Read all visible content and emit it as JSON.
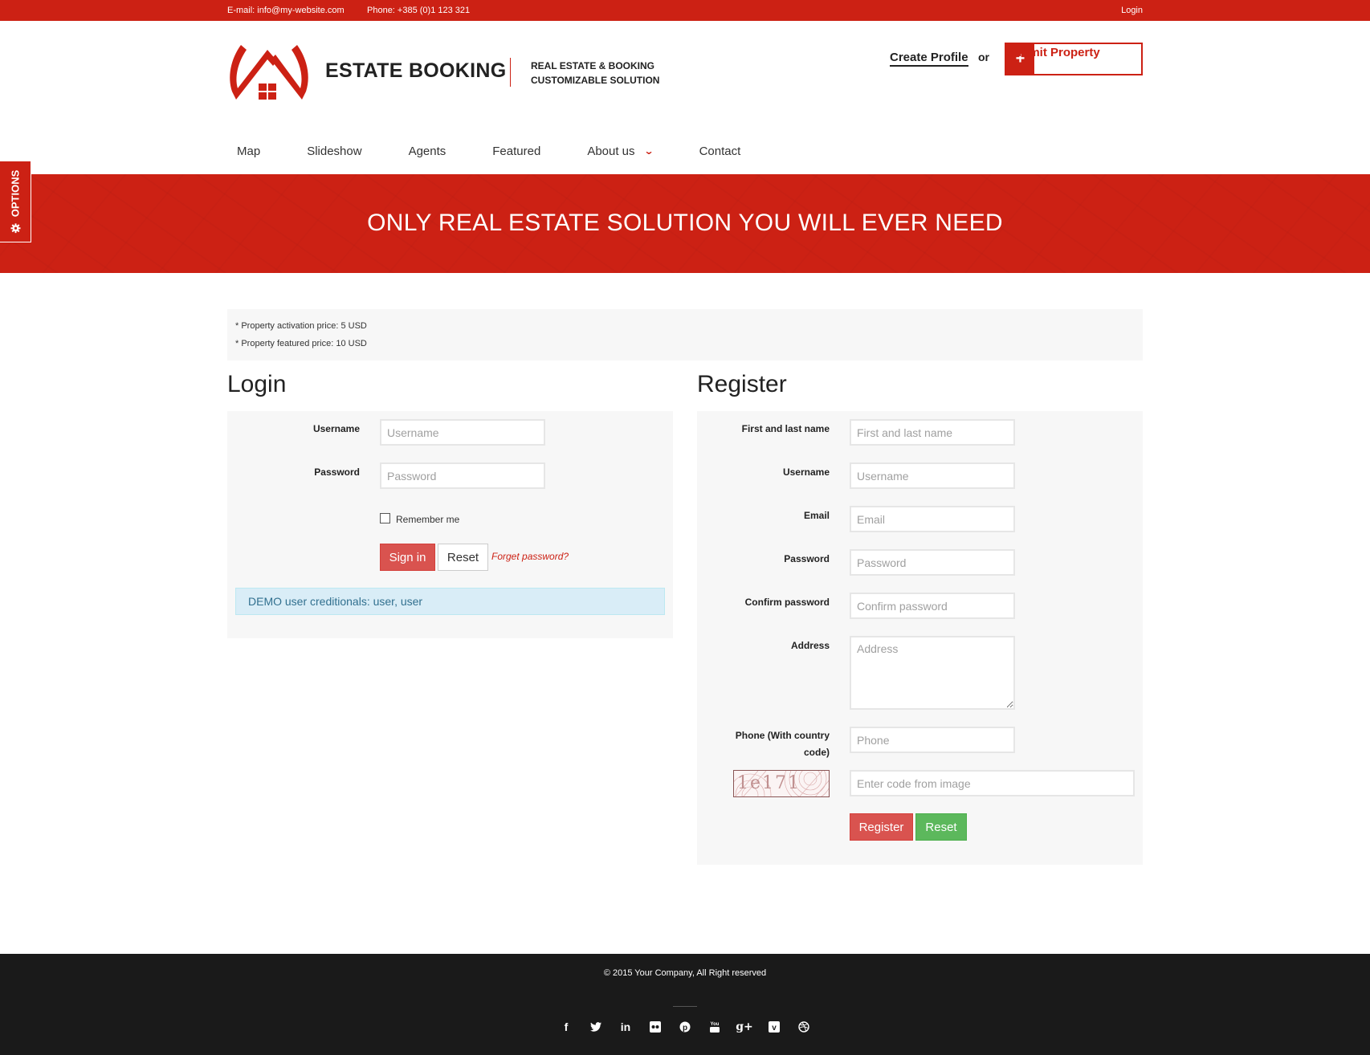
{
  "topbar": {
    "email": "E-mail: info@my-website.com",
    "phone": "Phone: +385 (0)1 123 321",
    "login": "Login"
  },
  "header": {
    "brand": "ESTATE BOOKING",
    "tagline_line1": "REAL ESTATE & BOOKING",
    "tagline_line2": "CUSTOMIZABLE SOLUTION",
    "create_profile": "Create Profile",
    "or": "or",
    "submit_plus": "+",
    "submit_property": "Submit Property"
  },
  "nav": {
    "items": [
      {
        "label": "Map"
      },
      {
        "label": "Slideshow"
      },
      {
        "label": "Agents"
      },
      {
        "label": "Featured"
      },
      {
        "label": "About us",
        "has_dropdown": true
      },
      {
        "label": "Contact"
      }
    ],
    "dropdown_icon": "chevron-down-icon"
  },
  "options_tab": {
    "label": "OPTIONS",
    "icon": "gear-icon"
  },
  "hero": {
    "title": "ONLY REAL ESTATE SOLUTION YOU WILL EVER NEED"
  },
  "notice": {
    "lines": [
      "* Property activation price: 5 USD",
      "* Property featured price: 10 USD"
    ]
  },
  "login": {
    "title": "Login",
    "username_label": "Username",
    "username_placeholder": "Username",
    "username_value": "",
    "password_label": "Password",
    "password_placeholder": "Password",
    "password_value": "",
    "remember_me": "Remember me",
    "remember_checked": false,
    "sign_in": "Sign in",
    "reset": "Reset",
    "forget_password": "Forget password?",
    "demo_info": "DEMO user creditionals: user, user"
  },
  "register": {
    "title": "Register",
    "fields": [
      {
        "label": "First and last name",
        "placeholder": "First and last name",
        "value": ""
      },
      {
        "label": "Username",
        "placeholder": "Username",
        "value": ""
      },
      {
        "label": "Email",
        "placeholder": "Email",
        "value": ""
      },
      {
        "label": "Password",
        "placeholder": "Password",
        "value": ""
      },
      {
        "label": "Confirm password",
        "placeholder": "Confirm password",
        "value": ""
      },
      {
        "label": "Address",
        "placeholder": "Address",
        "value": ""
      },
      {
        "label": "Phone (With country code)",
        "placeholder": "Phone",
        "value": ""
      }
    ],
    "phone_label_line1": "Phone (With country",
    "phone_label_line2": "code)",
    "captcha_code": "1e171",
    "captcha_placeholder": "Enter code from image",
    "register": "Register",
    "reset": "Reset"
  },
  "footer": {
    "copyright": "© 2015 Your Company, All Right reserved",
    "social": [
      {
        "name": "facebook-icon",
        "glyph": "f"
      },
      {
        "name": "twitter-icon",
        "glyph": "t"
      },
      {
        "name": "linkedin-icon",
        "glyph": "in"
      },
      {
        "name": "flickr-icon",
        "glyph": "••"
      },
      {
        "name": "pinterest-icon",
        "glyph": "p"
      },
      {
        "name": "youtube-icon",
        "glyph": "You"
      },
      {
        "name": "google-plus-icon",
        "glyph": "g+"
      },
      {
        "name": "vimeo-icon",
        "glyph": "v"
      },
      {
        "name": "dribbble-icon",
        "glyph": "⊛"
      }
    ]
  },
  "colors": {
    "brand_red": "#cc2114",
    "danger": "#d9534f",
    "success": "#5cb85c",
    "info_bg": "#d9edf7",
    "info_text": "#31708f",
    "panel_bg": "#f7f7f7",
    "footer_bg": "#1a1a1a"
  }
}
